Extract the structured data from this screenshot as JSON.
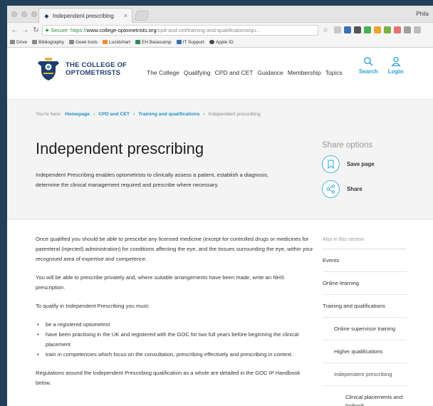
{
  "browser": {
    "tab_title": "Independent prescribing",
    "tab_close": "×",
    "profile": "Phila",
    "secure_label": "Secure",
    "url_proto": "https://",
    "url_host": "www.college-optometrists.org",
    "url_path": "/cpd-and-cet/training-and-qualifications/qu...",
    "bookmarks": [
      "Drive",
      "Bibliography",
      "Geek tools",
      "Lucidchart",
      "EH Basecamp",
      "IT Support",
      "Apple ID"
    ]
  },
  "header": {
    "logo_line1": "THE COLLEGE OF",
    "logo_line2": "OPTOMETRISTS",
    "nav": [
      "The College",
      "Qualifying",
      "CPD and CET",
      "Guidance",
      "Membership",
      "Topics"
    ],
    "search_label": "Search",
    "login_label": "Login"
  },
  "breadcrumb": {
    "prefix": "You're here:",
    "items": [
      "Homepage",
      "CPD and CET",
      "Training and qualifications"
    ],
    "current": "Independent prescribing"
  },
  "hero": {
    "title": "Independent prescribing",
    "intro": "Independent Prescribing enables optometrists to clinically assess a patient, establish a diagnosis, determine the clinical management required and prescribe where necessary."
  },
  "share": {
    "title": "Share options",
    "save_label": "Save page",
    "share_label": "Share"
  },
  "content": {
    "p1": "Once qualified you should be able to prescribe any licensed medicine (except for controlled drugs or medicines for parenteral (injected) administration) for conditions affecting the eye, and the tissues surrounding the eye, within your recognised area of expertise and competence.",
    "p2": "You will be able to prescribe privately and, where suitable arrangements have been made, write an NHS prescription.",
    "p3": "To qualify in Independent Prescribing you must:",
    "bullets": [
      "be a registered optometrist",
      "have been practising in the UK and registered with the GOC for two full years before beginning the clinical placement",
      "train in competencies which focus on the consultation, prescribing effectively and prescribing in context."
    ],
    "p4": "Regulations around the Independent Prescribing qualification as a whole are detailed in the GOC IP Handbook below."
  },
  "sidebar": {
    "heading": "Also in this section",
    "items": [
      "Events",
      "Online learning",
      "Training and qualifications",
      "Online supervisor training",
      "Higher qualifications",
      "Independent prescribing",
      "Clinical placements and logbook"
    ]
  },
  "colors": {
    "brand_navy": "#1f3d6b",
    "accent_blue": "#2b9ed6",
    "link_blue": "#1a8fc7"
  }
}
